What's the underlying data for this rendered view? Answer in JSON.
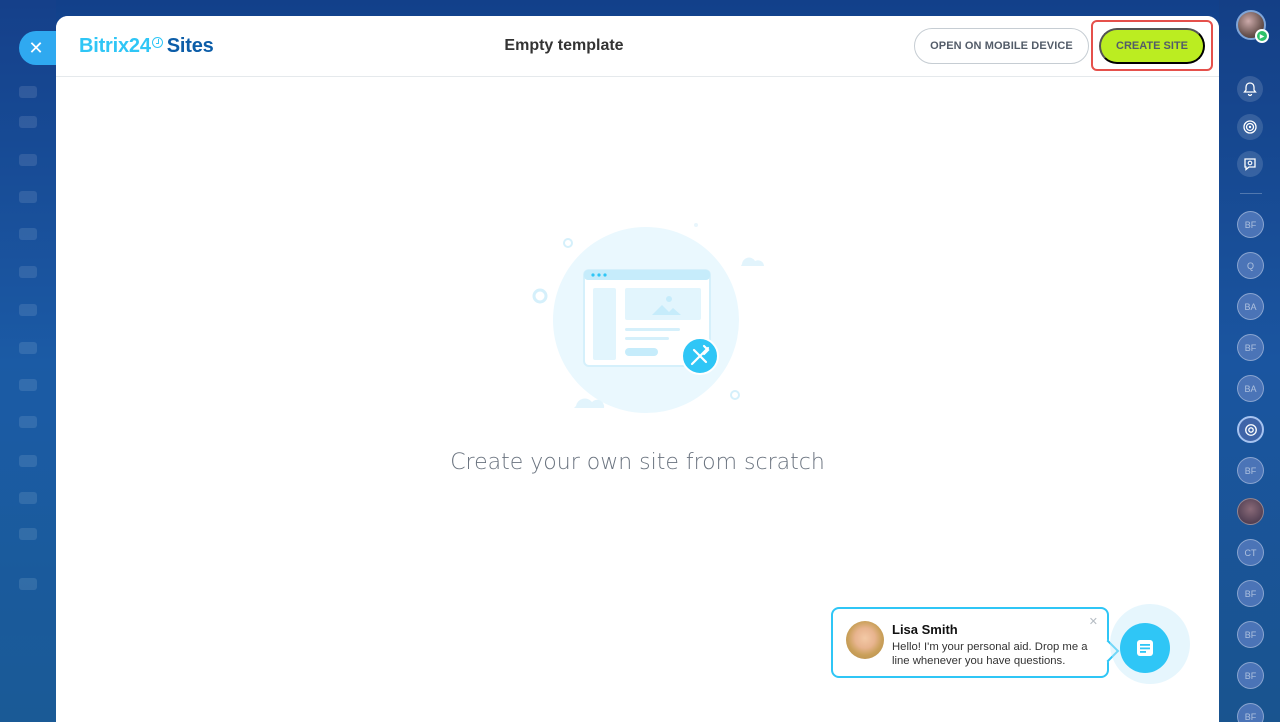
{
  "header": {
    "logo_brand": "Bitrix24",
    "logo_product": "Sites",
    "title": "Empty template",
    "mobile_button": "OPEN ON MOBILE DEVICE",
    "create_button": "CREATE SITE"
  },
  "main": {
    "caption": "Create your own site from scratch"
  },
  "chat": {
    "name": "Lisa Smith",
    "message": "Hello! I'm your personal aid. Drop me a line whenever you have questions."
  },
  "right_sidebar": {
    "chats": [
      "BF",
      "Q",
      "BA",
      "BF",
      "BA",
      "",
      "BF",
      "",
      "CT",
      "BF",
      "BF",
      "BF",
      "BF"
    ]
  },
  "colors": {
    "accent": "#2fc6f6",
    "create_button": "#bbed21",
    "highlight": "#e5504b"
  }
}
